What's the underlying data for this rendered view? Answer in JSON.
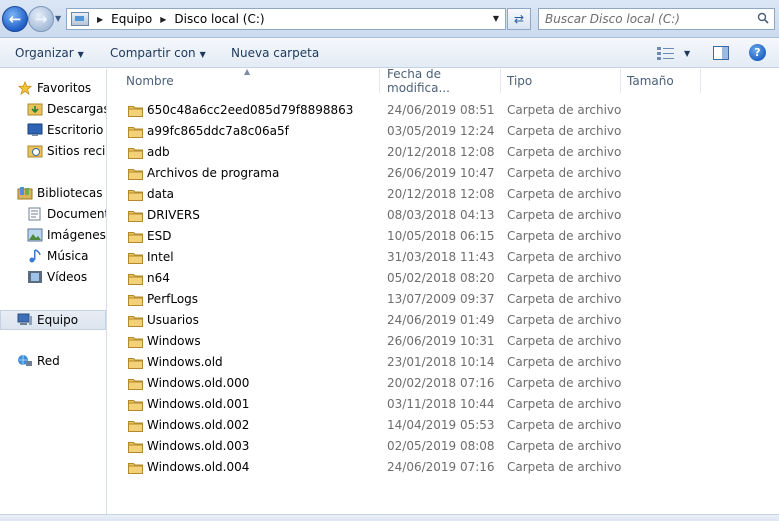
{
  "address": {
    "crumbs": [
      "Equipo",
      "Disco local (C:)"
    ],
    "search_placeholder": "Buscar Disco local (C:)"
  },
  "commands": {
    "organize": "Organizar",
    "share": "Compartir con",
    "new_folder": "Nueva carpeta"
  },
  "nav": {
    "favorites": "Favoritos",
    "downloads": "Descargas",
    "desktop": "Escritorio",
    "recent": "Sitios recientes",
    "libraries": "Bibliotecas",
    "documents": "Documentos",
    "pictures": "Imágenes",
    "music": "Música",
    "videos": "Vídeos",
    "computer": "Equipo",
    "network": "Red"
  },
  "columns": {
    "name": "Nombre",
    "date": "Fecha de modifica...",
    "type": "Tipo",
    "size": "Tamaño"
  },
  "files": [
    {
      "name": "650c48a6cc2eed085d79f8898863",
      "date": "24/06/2019 08:51 ...",
      "type": "Carpeta de archivos"
    },
    {
      "name": "a99fc865ddc7a8c06a5f",
      "date": "03/05/2019 12:24 a...",
      "type": "Carpeta de archivos"
    },
    {
      "name": "adb",
      "date": "20/12/2018 12:08 ...",
      "type": "Carpeta de archivos"
    },
    {
      "name": "Archivos de programa",
      "date": "26/06/2019 10:47 ...",
      "type": "Carpeta de archivos"
    },
    {
      "name": "data",
      "date": "20/12/2018 12:08 ...",
      "type": "Carpeta de archivos"
    },
    {
      "name": "DRIVERS",
      "date": "08/03/2018 04:13 ...",
      "type": "Carpeta de archivos"
    },
    {
      "name": "ESD",
      "date": "10/05/2018 06:15 ...",
      "type": "Carpeta de archivos"
    },
    {
      "name": "Intel",
      "date": "31/03/2018 11:43 a...",
      "type": "Carpeta de archivos"
    },
    {
      "name": "n64",
      "date": "05/02/2018 08:20 ...",
      "type": "Carpeta de archivos"
    },
    {
      "name": "PerfLogs",
      "date": "13/07/2009 09:37 ...",
      "type": "Carpeta de archivos"
    },
    {
      "name": "Usuarios",
      "date": "24/06/2019 01:49 ...",
      "type": "Carpeta de archivos"
    },
    {
      "name": "Windows",
      "date": "26/06/2019 10:31 ...",
      "type": "Carpeta de archivos"
    },
    {
      "name": "Windows.old",
      "date": "23/01/2018 10:14 a...",
      "type": "Carpeta de archivos"
    },
    {
      "name": "Windows.old.000",
      "date": "20/02/2018 07:16 a...",
      "type": "Carpeta de archivos"
    },
    {
      "name": "Windows.old.001",
      "date": "03/11/2018 10:44 a...",
      "type": "Carpeta de archivos"
    },
    {
      "name": "Windows.old.002",
      "date": "14/04/2019 05:53 ...",
      "type": "Carpeta de archivos"
    },
    {
      "name": "Windows.old.003",
      "date": "02/05/2019 08:08 a...",
      "type": "Carpeta de archivos"
    },
    {
      "name": "Windows.old.004",
      "date": "24/06/2019 07:16 a...",
      "type": "Carpeta de archivos"
    }
  ]
}
